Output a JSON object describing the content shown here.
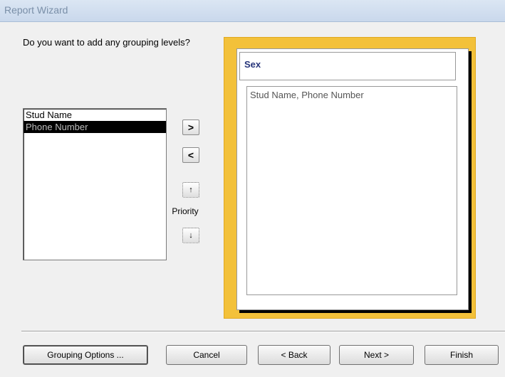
{
  "window": {
    "title": "Report Wizard"
  },
  "question": "Do you want to add any grouping levels?",
  "fields": {
    "items": [
      {
        "label": "Stud Name",
        "selected": false
      },
      {
        "label": "Phone Number",
        "selected": true
      }
    ]
  },
  "move_buttons": {
    "add": ">",
    "remove": "<",
    "up": "↑",
    "down": "↓"
  },
  "priority_label": "Priority",
  "preview": {
    "group_header": "Sex",
    "detail_fields": "Stud Name, Phone Number"
  },
  "footer": {
    "grouping_options": "Grouping Options ...",
    "cancel": "Cancel",
    "back": "< Back",
    "next": "Next >",
    "finish": "Finish"
  },
  "colors": {
    "preview_border": "#f3c13a",
    "group_header_text": "#27357a",
    "selection": "#000000"
  }
}
